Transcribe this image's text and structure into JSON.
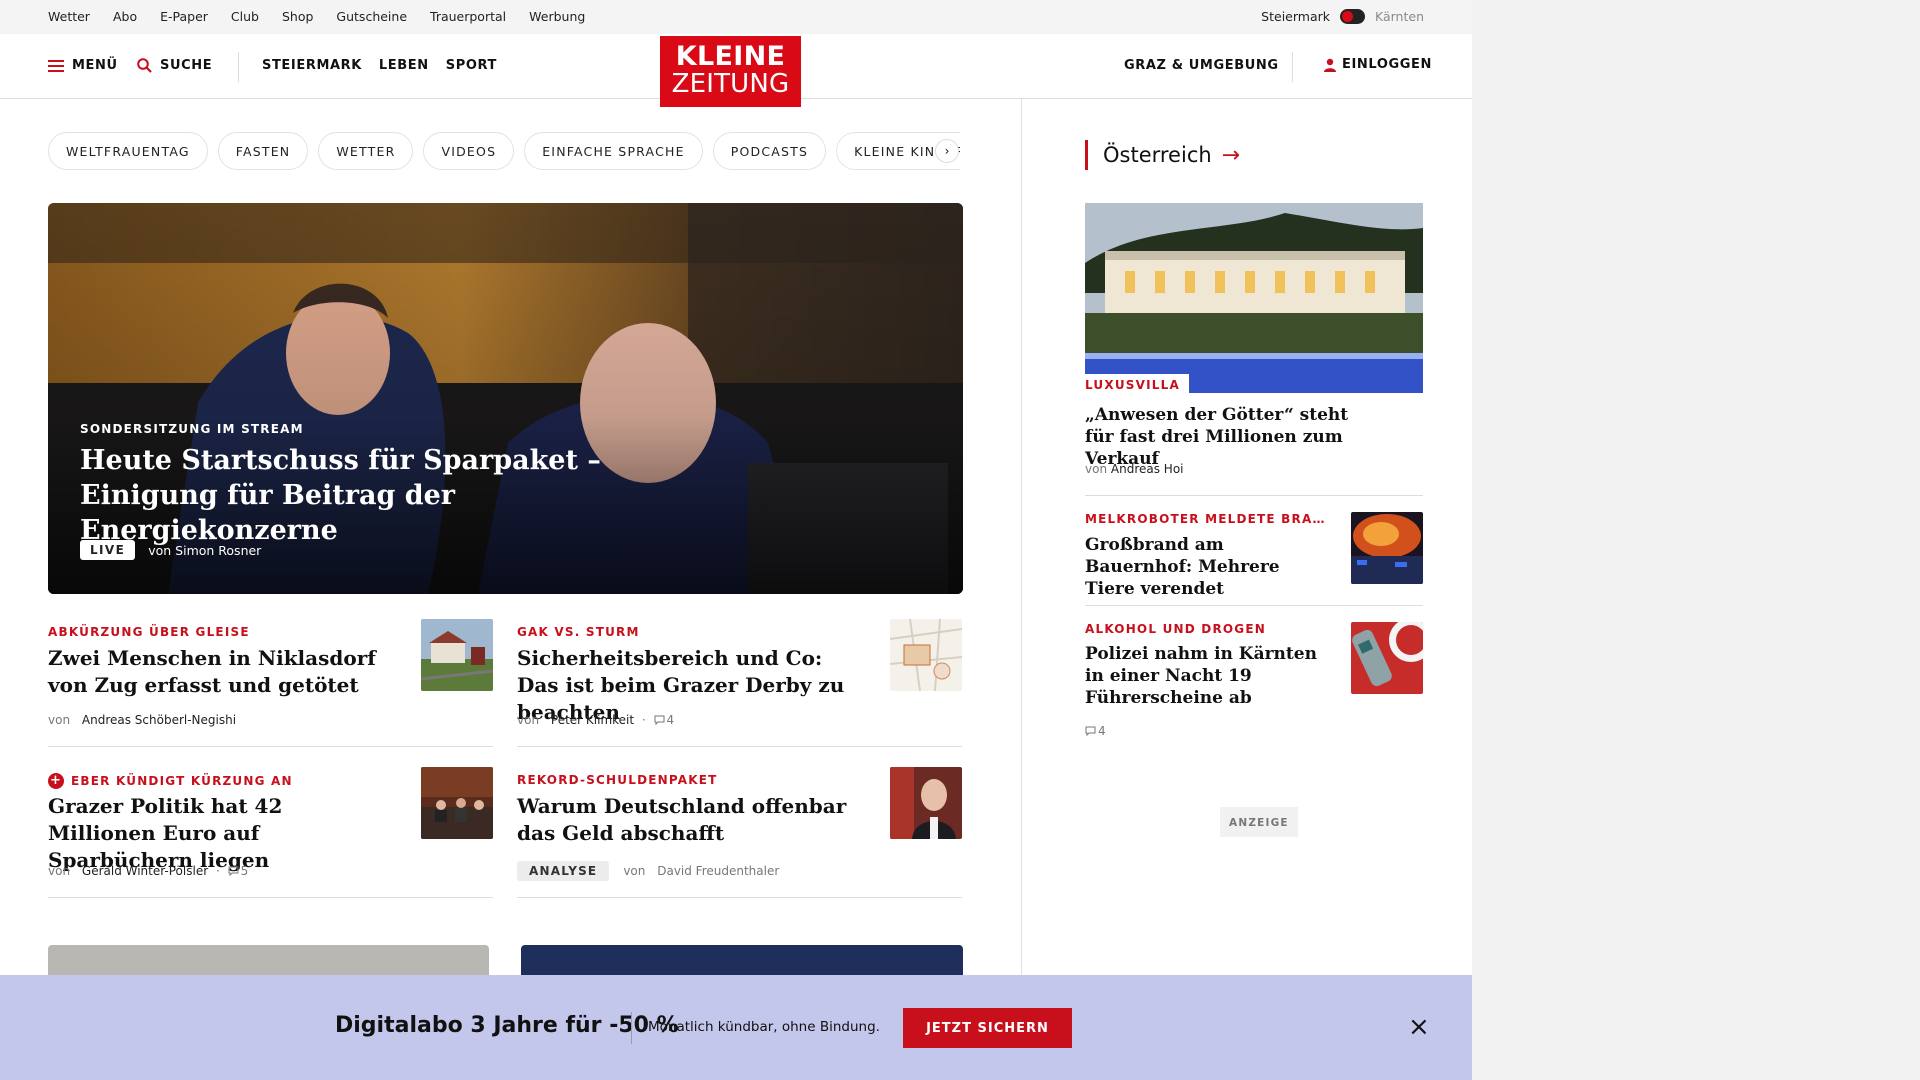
{
  "topbar": {
    "links": [
      "Wetter",
      "Abo",
      "E-Paper",
      "Club",
      "Shop",
      "Gutscheine",
      "Trauerportal",
      "Werbung"
    ],
    "region_active": "Steiermark",
    "region_inactive": "Kärnten"
  },
  "header": {
    "menu_label": "MENÜ",
    "search_label": "SUCHE",
    "sections": [
      "STEIERMARK",
      "LEBEN",
      "SPORT"
    ],
    "logo_line1": "KLEINE",
    "logo_line2": "ZEITUNG",
    "local_label": "GRAZ & UMGEBUNG",
    "login_label": "EINLOGGEN"
  },
  "chips": [
    "WELTFRAUENTAG",
    "FASTEN",
    "WETTER",
    "VIDEOS",
    "EINFACHE SPRACHE",
    "PODCASTS",
    "KLEINE KINDERZEITUNG"
  ],
  "hero": {
    "kicker": "SONDERSITZUNG IM STREAM",
    "title": "Heute Startschuss für Sparpaket – Einigung für Beitrag der Energiekonzerne",
    "badge": "LIVE",
    "by_prefix": "von",
    "author": "Simon Rosner"
  },
  "articles": [
    {
      "kicker": "ABKÜRZUNG ÜBER GLEISE",
      "title": "Zwei Menschen in Niklasdorf von Zug erfasst und getötet",
      "by_prefix": "von",
      "author": "Andreas Schöberl-Negishi"
    },
    {
      "kicker": "GAK VS. STURM",
      "title": "Sicherheitsbereich und Co: Das ist beim Grazer Derby zu beachten",
      "by_prefix": "von",
      "author": "Peter Klimkeit",
      "comments": "4"
    },
    {
      "kicker": "EBER KÜNDIGT KÜRZUNG AN",
      "title": "Grazer Politik hat 42 Millionen Euro auf Sparbüchern liegen",
      "by_prefix": "von",
      "author": "Gerald Winter-Pölsler",
      "comments": "5"
    },
    {
      "kicker": "REKORD-SCHULDENPAKET",
      "title": "Warum Deutschland offenbar das Geld abschafft",
      "badge": "ANALYSE",
      "by_prefix": "von",
      "author": "David Freudenthaler"
    }
  ],
  "sidebar": {
    "heading": "Österreich",
    "main": {
      "kicker": "LUXUSVILLA",
      "title": "„Anwesen der Götter“ steht für fast drei Millionen zum Verkauf",
      "by_prefix": "von",
      "author": "Andreas Hoi"
    },
    "items": [
      {
        "kicker": "MELKROBOTER MELDETE BRA…",
        "title": "Großbrand am Bauernhof: Mehrere Tiere verendet"
      },
      {
        "kicker": "ALKOHOL UND DROGEN",
        "title": "Polizei nahm in Kärnten in einer Nacht 19 Führerscheine ab",
        "comments": "4"
      }
    ],
    "ad_label": "ANZEIGE"
  },
  "promo": {
    "headline": "Digitalabo 3 Jahre für -50 %",
    "sub": "Monatlich kündbar, ohne Bindung.",
    "cta": "JETZT SICHERN",
    "close": "×"
  },
  "colors": {
    "brand_red": "#d90a16",
    "kicker_red": "#c8101c",
    "promo_bg": "#c4c7ec"
  }
}
